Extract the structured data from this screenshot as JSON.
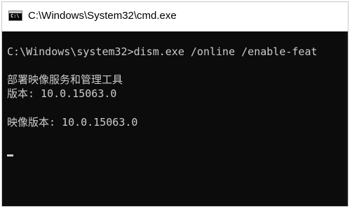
{
  "window": {
    "title": "C:\\Windows\\System32\\cmd.exe",
    "icon": "cmd-console-icon",
    "icon_text": "C:\\"
  },
  "console": {
    "lines": [
      "C:\\Windows\\system32>dism.exe /online /enable-feat",
      "部署映像服务和管理工具",
      "版本: 10.0.15063.0",
      "映像版本: 10.0.15063.0"
    ],
    "text_color": "#cccccc",
    "background_color": "#0c0c0c"
  }
}
